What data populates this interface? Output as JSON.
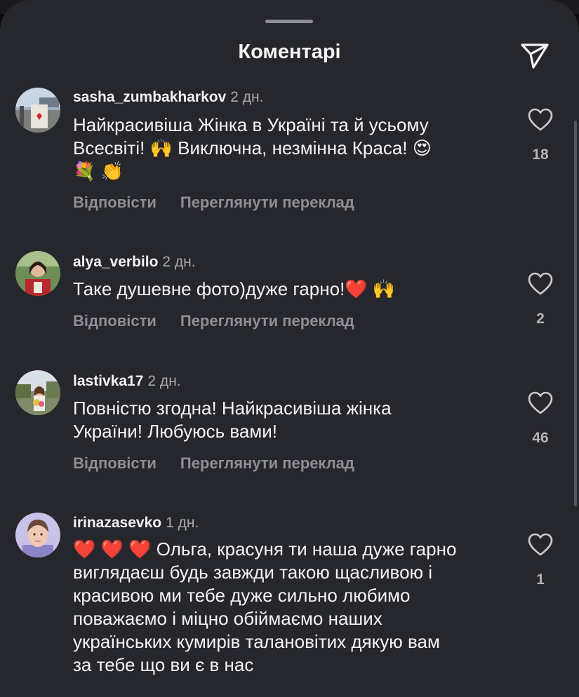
{
  "header": {
    "title": "Коментарі"
  },
  "actions": {
    "reply": "Відповісти",
    "translate": "Переглянути переклад"
  },
  "comments": [
    {
      "username": "sasha_zumbakharkov",
      "time": "2 дн.",
      "text": "Найкрасивіша Жінка в Україні та й усьому\nВсесвіті! 🙌 Виключна, незмінна Краса! 😍\n💐 👏",
      "likes": "18"
    },
    {
      "username": "alya_verbilo",
      "time": "2 дн.",
      "text": "Таке душевне фото)дуже гарно!❤️ 🙌",
      "likes": "2"
    },
    {
      "username": "lastivka17",
      "time": "2 дн.",
      "text": "Повністю згодна! Найкрасивіша жінка\nУкраїни! Любуюсь вами!",
      "likes": "46"
    },
    {
      "username": "irinazasevko",
      "time": "1 дн.",
      "text": "❤️ ❤️ ❤️  Ольга, красуня ти наша дуже гарно\nвиглядаєш будь завжди такою щасливою і\nкрасивою ми тебе дуже сильно любимо\nповажаємо і міцно обіймаємо наших\nукраїнських кумирів талановітих дякую вам\nза тебе що ви є в нас",
      "likes": "1"
    }
  ],
  "icons": {
    "send": "send-icon",
    "like": "heart-icon"
  },
  "colors": {
    "sheet_bg": "#26272c",
    "text_primary": "#f4f4f4",
    "text_secondary": "#8e8f95"
  }
}
